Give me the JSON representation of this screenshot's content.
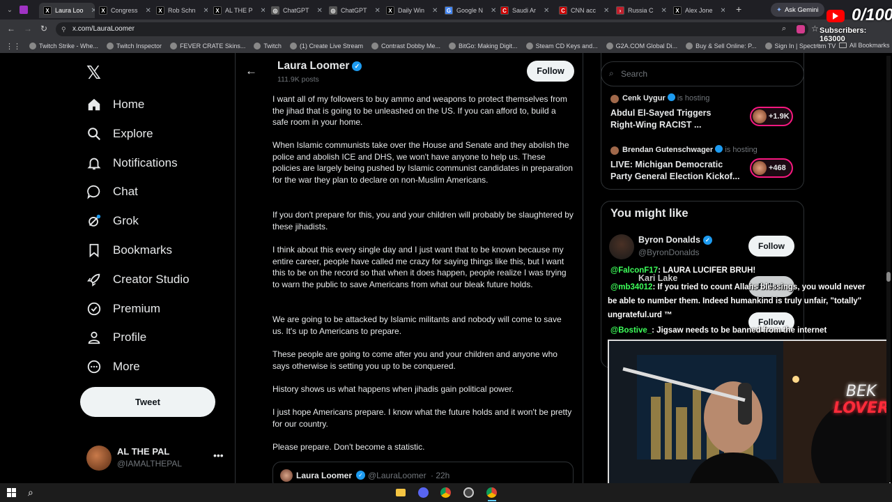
{
  "browser": {
    "tabs": [
      {
        "label": "Laura Loo",
        "fav": "X",
        "color": "#000000",
        "active": true
      },
      {
        "label": "Congress",
        "fav": "X",
        "color": "#000000"
      },
      {
        "label": "Rob Schn",
        "fav": "X",
        "color": "#000000"
      },
      {
        "label": "AL THE P",
        "fav": "X",
        "color": "#000000"
      },
      {
        "label": "ChatGPT",
        "fav": "◎",
        "color": "#555555"
      },
      {
        "label": "ChatGPT",
        "fav": "◎",
        "color": "#555555"
      },
      {
        "label": "Daily Win",
        "fav": "X",
        "color": "#000000"
      },
      {
        "label": "Google N",
        "fav": "G",
        "color": "#4285f4"
      },
      {
        "label": "Saudi Ar",
        "fav": "C",
        "color": "#cc0000"
      },
      {
        "label": "CNN acc",
        "fav": "C",
        "color": "#cc0000"
      },
      {
        "label": "Russia C",
        "fav": "›",
        "color": "#c21f2c"
      },
      {
        "label": "Alex Jone",
        "fav": "X",
        "color": "#000000"
      }
    ],
    "new_tab": "+",
    "ask_gemini": "Ask Gemini",
    "url": "x.com/LauraLoomer",
    "bookmarks": [
      "Twitch Strike - Whe...",
      "Twitch Inspector",
      "FEVER CRATE Skins...",
      "Twitch",
      "(1) Create Live Stream",
      "Contrast Dobby Me...",
      "BitGo: Making Digit...",
      "Steam CD Keys and...",
      "G2A.COM Global Di...",
      "Buy & Sell Online: P...",
      "Sign In | Spectrum TV"
    ],
    "all_bookmarks": "All Bookmarks"
  },
  "overlay": {
    "sub_count": "0/100",
    "subscribers": "Subscribers: 163000",
    "webcam_text_1": "BEK",
    "webcam_text_2": "LOVER"
  },
  "nav": {
    "items": [
      {
        "label": "Home",
        "icon": "home-icon"
      },
      {
        "label": "Explore",
        "icon": "search-icon"
      },
      {
        "label": "Notifications",
        "icon": "bell-icon"
      },
      {
        "label": "Chat",
        "icon": "chat-icon"
      },
      {
        "label": "Grok",
        "icon": "grok-icon"
      },
      {
        "label": "Bookmarks",
        "icon": "bookmark-icon"
      },
      {
        "label": "Creator Studio",
        "icon": "rocket-icon"
      },
      {
        "label": "Premium",
        "icon": "verified-icon"
      },
      {
        "label": "Profile",
        "icon": "person-icon"
      },
      {
        "label": "More",
        "icon": "more-circle-icon"
      }
    ],
    "tweet_label": "Tweet",
    "account": {
      "name": "AL THE PAL",
      "handle": "@IAMALTHEPAL"
    }
  },
  "profile_header": {
    "name": "Laura Loomer",
    "posts": "111.9K posts",
    "follow_label": "Follow"
  },
  "post": {
    "paragraphs": [
      "I want all of my followers to buy ammo and weapons to protect themselves from the jihad that is going to be unleashed on the US. If you can afford to, build a safe room in your home.",
      "When Islamic communists take over the House and Senate and they abolish the police and abolish ICE and DHS, we won't have anyone to help us. These policies are largely being pushed by Islamic communist candidates in preparation for the war they plan to declare on non-Muslim Americans.",
      "If you don't prepare for this, you and your children will probably be slaughtered by these jihadists.",
      "I think about this every single day and I just want that to be known because my entire career, people have called me crazy for saying things like this, but I want this to be on the record so that when it does happen, people realize I was trying to warn the public to save Americans from what our bleak future holds.",
      "We are going to be attacked by Islamic militants and nobody will come to save us. It's up to Americans to prepare.",
      "These people are going to come after you and your children and anyone who says otherwise is setting you up to be conquered.",
      "History shows us what happens when jihadis gain political power.",
      "I just hope Americans prepare. I know what the future holds and it won't be pretty for our country.",
      "Please prepare. Don't become a statistic."
    ],
    "quoted": {
      "name": "Laura Loomer",
      "handle": "@LauraLoomer",
      "time": "· 22h"
    }
  },
  "right": {
    "search_placeholder": "Search",
    "spaces": [
      {
        "host": "Cenk Uygur",
        "hosting": "is hosting",
        "title1": "Abdul El-Sayed Triggers",
        "title2": "Right-Wing RACIST ...",
        "count": "+1.9K"
      },
      {
        "host": "Brendan Gutenschwager",
        "hosting": "is hosting",
        "title1": "LIVE: Michigan Democratic",
        "title2": "Party General Election Kickof...",
        "count": "+468"
      }
    ],
    "you_might_like": "You might like",
    "suggestions": [
      {
        "name": "Byron Donalds",
        "handle": "@ByronDonalds",
        "follow": "Follow"
      },
      {
        "name": "Kari Lake",
        "handle": "",
        "follow": "Follow"
      },
      {
        "name": "",
        "handle": "",
        "follow": "Follow"
      }
    ]
  },
  "chat": [
    {
      "user": "@FalconF17",
      "msg": ": LAURA LUCIFER BRUH!"
    },
    {
      "user": "@mb34012",
      "msg": ": If you tried to count Allahs blessings, you would never"
    },
    {
      "user": "",
      "msg": "be able to number them. Indeed humankind is truly unfair, \"totally\""
    },
    {
      "user": "",
      "msg": "ungrateful.urd ™"
    },
    {
      "user": "@Bostive_",
      "msg": ": Jigsaw needs to be banned from the internet"
    }
  ],
  "colors": {
    "verified": "#1d9bf0",
    "chat_user": "#3dff5a",
    "live_ring": "#f91880"
  }
}
